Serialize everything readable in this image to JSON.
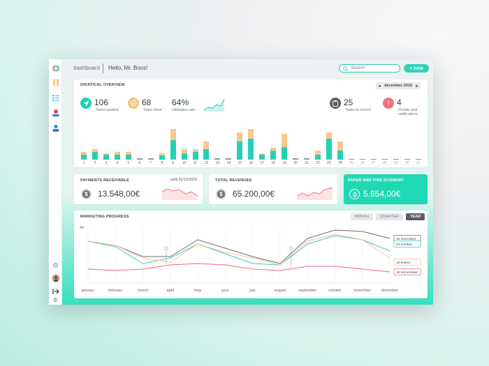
{
  "header": {
    "breadcrumb": "dashboard",
    "greeting": "Hello, Mr. Boos!",
    "search_placeholder": "Search",
    "new_button": "+ new"
  },
  "sidebar": {
    "icons": [
      "logo-icon",
      "users-icon",
      "list-icon",
      "alert-user-icon",
      "user-icon",
      "gear-icon",
      "avatar",
      "export-icon",
      "copyright-icon"
    ]
  },
  "overview": {
    "title": "DIDATICAL OVERVIEW",
    "month": "december 2019",
    "stats": [
      {
        "value": "106",
        "label": "Tasks sended",
        "color": "#1fd3b0"
      },
      {
        "value": "68",
        "label": "Tasks done",
        "color": "#f7c17c"
      },
      {
        "value": "64%",
        "label": "Utilization rate",
        "color": "#1fd3b0"
      },
      {
        "value": "25",
        "label": "Tasks to correct",
        "color": "#5b5f64"
      },
      {
        "value": "4",
        "label": "Doubts and notifications",
        "color": "#f2717a"
      }
    ]
  },
  "chart_data": [
    {
      "type": "bar",
      "categories": [
        "1",
        "2",
        "3",
        "4",
        "5",
        "6",
        "7",
        "8",
        "9",
        "10",
        "11",
        "12",
        "13",
        "14",
        "15",
        "16",
        "17",
        "18",
        "19",
        "20",
        "21",
        "22",
        "23",
        "24",
        "25",
        "26",
        "27",
        "28",
        "29",
        "30",
        "31"
      ],
      "series": [
        {
          "name": "done",
          "values": [
            4,
            6,
            4,
            4,
            4,
            0.5,
            0.5,
            3,
            15,
            5,
            6,
            8,
            0.5,
            0.5,
            14,
            16,
            4,
            7,
            10,
            0.5,
            0.5,
            4,
            16,
            7,
            0,
            0,
            0,
            0,
            0,
            0,
            0
          ],
          "color": "#23d2b2"
        },
        {
          "name": "sended",
          "values": [
            2,
            2,
            1,
            2,
            2,
            0.5,
            0.5,
            2,
            9,
            3,
            2,
            6,
            0.5,
            0.5,
            7,
            8,
            1,
            2,
            10,
            0.5,
            0.5,
            3,
            5,
            7,
            0.5,
            0.5,
            0.5,
            0.5,
            0.5,
            0.5,
            0.5
          ],
          "color": "#f9c78a"
        }
      ]
    },
    {
      "type": "line",
      "title": "MARKETING PROGRESS",
      "categories": [
        "january",
        "february",
        "march",
        "april",
        "may",
        "june",
        "july",
        "august",
        "september",
        "october",
        "november",
        "december"
      ],
      "ylim": [
        0,
        40
      ],
      "yticks": [
        40
      ],
      "series": [
        {
          "name": "25 interested",
          "values": [
            30,
            27,
            19,
            19,
            31,
            25,
            19,
            14,
            32,
            38,
            37,
            32
          ],
          "color": "#6a6e74"
        },
        {
          "name": "20 enroled",
          "values": [
            30,
            26,
            14,
            18,
            28,
            21,
            14,
            13,
            28,
            34,
            31,
            23
          ],
          "color": "#39cbc0"
        },
        {
          "name": "10 tested",
          "values": [
            30,
            27,
            18,
            15,
            28,
            22,
            18,
            13,
            30,
            35,
            31,
            18
          ],
          "color": "#f8c48c"
        },
        {
          "name": "10 not enroled",
          "values": [
            10,
            9,
            10,
            13,
            14,
            13,
            10,
            9,
            12,
            12,
            10,
            8
          ],
          "color": "#f2657a"
        }
      ]
    }
  ],
  "payments": {
    "title": "PAYMENTS RECEIVABLE",
    "until": "until 31/12/2019",
    "value": "13.548,00€"
  },
  "revenues": {
    "title": "TOTAL REVENUES",
    "value": "65.200,00€"
  },
  "economy": {
    "title": "PAPER AND TIME ECONOMY",
    "value": "5.654,00€"
  },
  "marketing": {
    "title": "MARKETING PROGRESS",
    "ranges": [
      "MONTH",
      "QUARTER",
      "YEAR"
    ],
    "active_range": "YEAR",
    "y_top_label": "40",
    "legend": [
      "25 interested",
      "20 enroled",
      "10 tested",
      "10 not enroled"
    ]
  }
}
